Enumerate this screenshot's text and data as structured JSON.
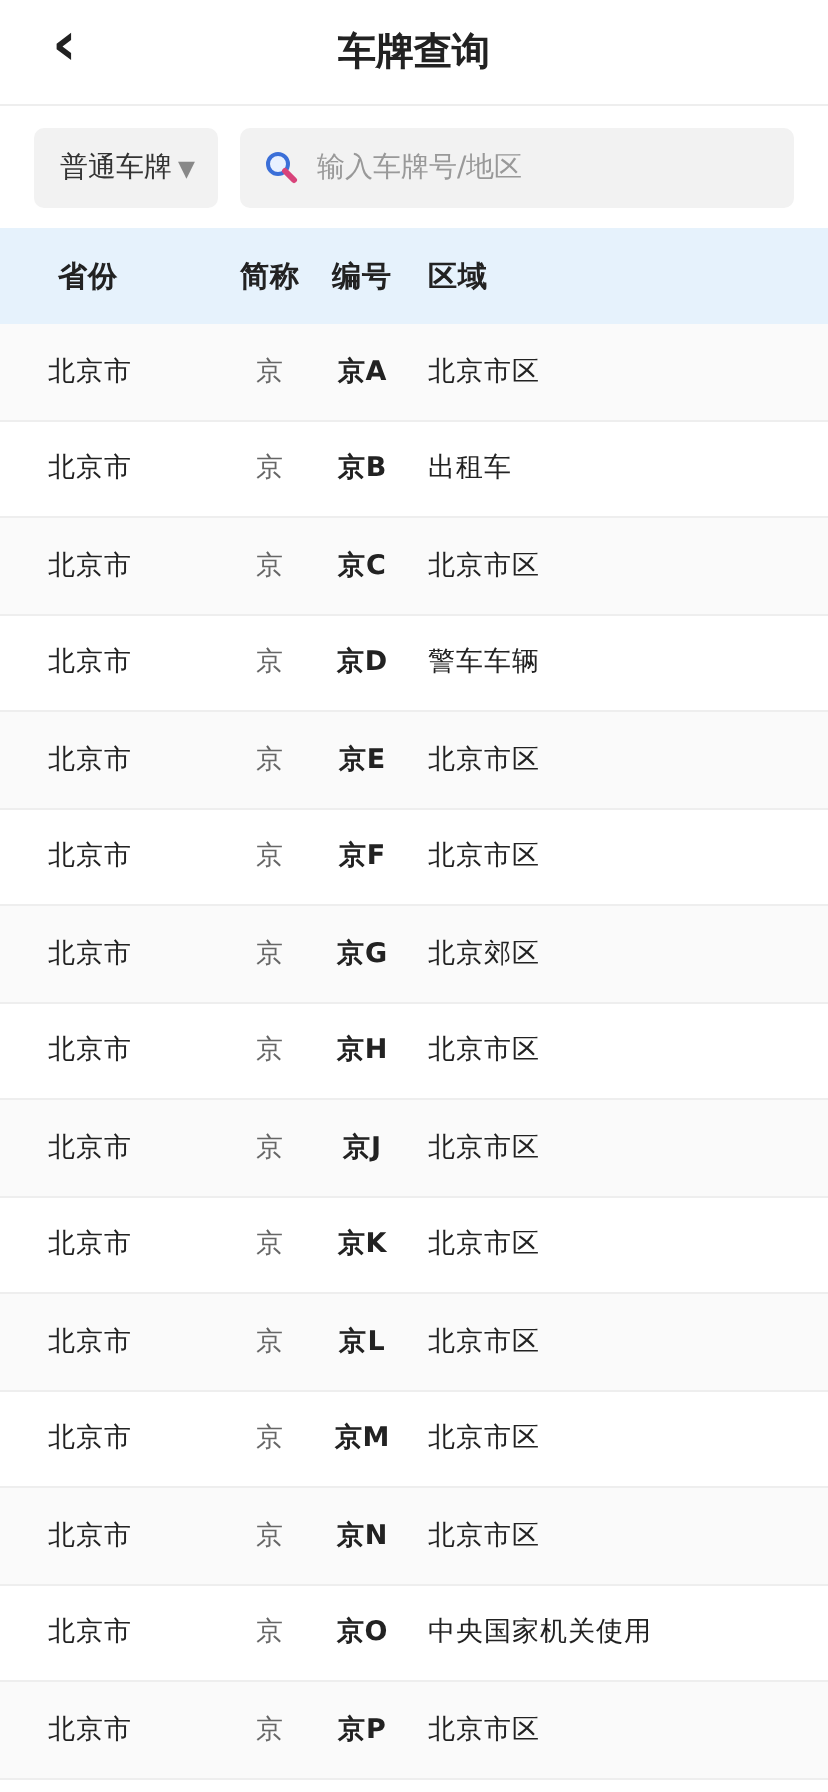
{
  "header": {
    "back": "‹",
    "title": "车牌查询"
  },
  "filter": {
    "type": "普通车牌",
    "caret": "▼",
    "placeholder": "输入车牌号/地区"
  },
  "table": {
    "columns": [
      "省份",
      "简称",
      "编号",
      "区域"
    ],
    "rows": [
      [
        "北京市",
        "京",
        "京A",
        "北京市区"
      ],
      [
        "北京市",
        "京",
        "京B",
        "出租车"
      ],
      [
        "北京市",
        "京",
        "京C",
        "北京市区"
      ],
      [
        "北京市",
        "京",
        "京D",
        "警车车辆"
      ],
      [
        "北京市",
        "京",
        "京E",
        "北京市区"
      ],
      [
        "北京市",
        "京",
        "京F",
        "北京市区"
      ],
      [
        "北京市",
        "京",
        "京G",
        "北京郊区"
      ],
      [
        "北京市",
        "京",
        "京H",
        "北京市区"
      ],
      [
        "北京市",
        "京",
        "京J",
        "北京市区"
      ],
      [
        "北京市",
        "京",
        "京K",
        "北京市区"
      ],
      [
        "北京市",
        "京",
        "京L",
        "北京市区"
      ],
      [
        "北京市",
        "京",
        "京M",
        "北京市区"
      ],
      [
        "北京市",
        "京",
        "京N",
        "北京市区"
      ],
      [
        "北京市",
        "京",
        "京O",
        "中央国家机关使用"
      ],
      [
        "北京市",
        "京",
        "京P",
        "北京市区"
      ]
    ]
  }
}
